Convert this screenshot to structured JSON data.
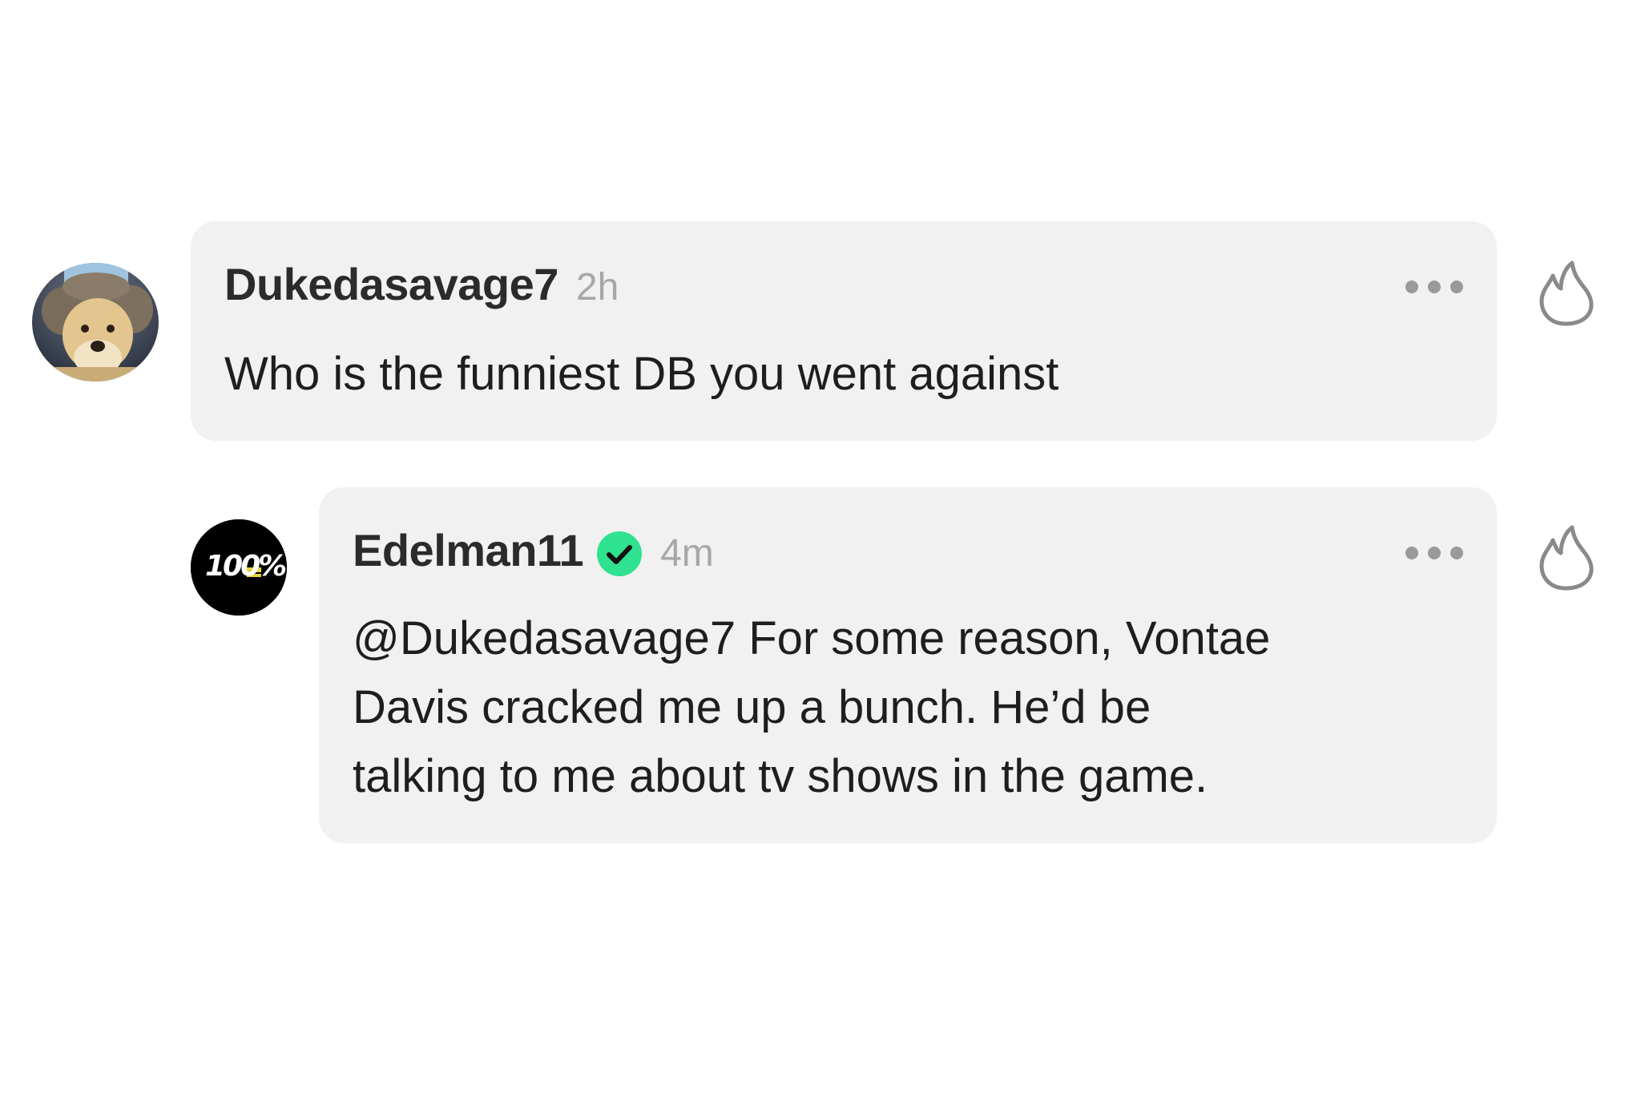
{
  "comments": [
    {
      "username": "Dukedasavage7",
      "time": "2h",
      "lines": [
        "Who is the funniest DB you went against"
      ],
      "avatar_icon": "dog-avatar",
      "verified": false
    },
    {
      "username": "Edelman11",
      "time": "4m",
      "lines": [
        "@Dukedasavage7 For some reason, Vontae",
        "Davis cracked me up a bunch. He’d be",
        "talking to me about tv shows in the game."
      ],
      "avatar_icon": "100-percent-logo-avatar",
      "avatar_logo_text": "100%",
      "verified": true
    }
  ],
  "icons": {
    "more": "more-options-icon",
    "like": "fire-icon",
    "verified": "verified-check-icon"
  },
  "colors": {
    "bubble_bg": "#f1f1f1",
    "verified_green": "#2ee28f",
    "timestamp_gray": "#a7a7a7"
  }
}
